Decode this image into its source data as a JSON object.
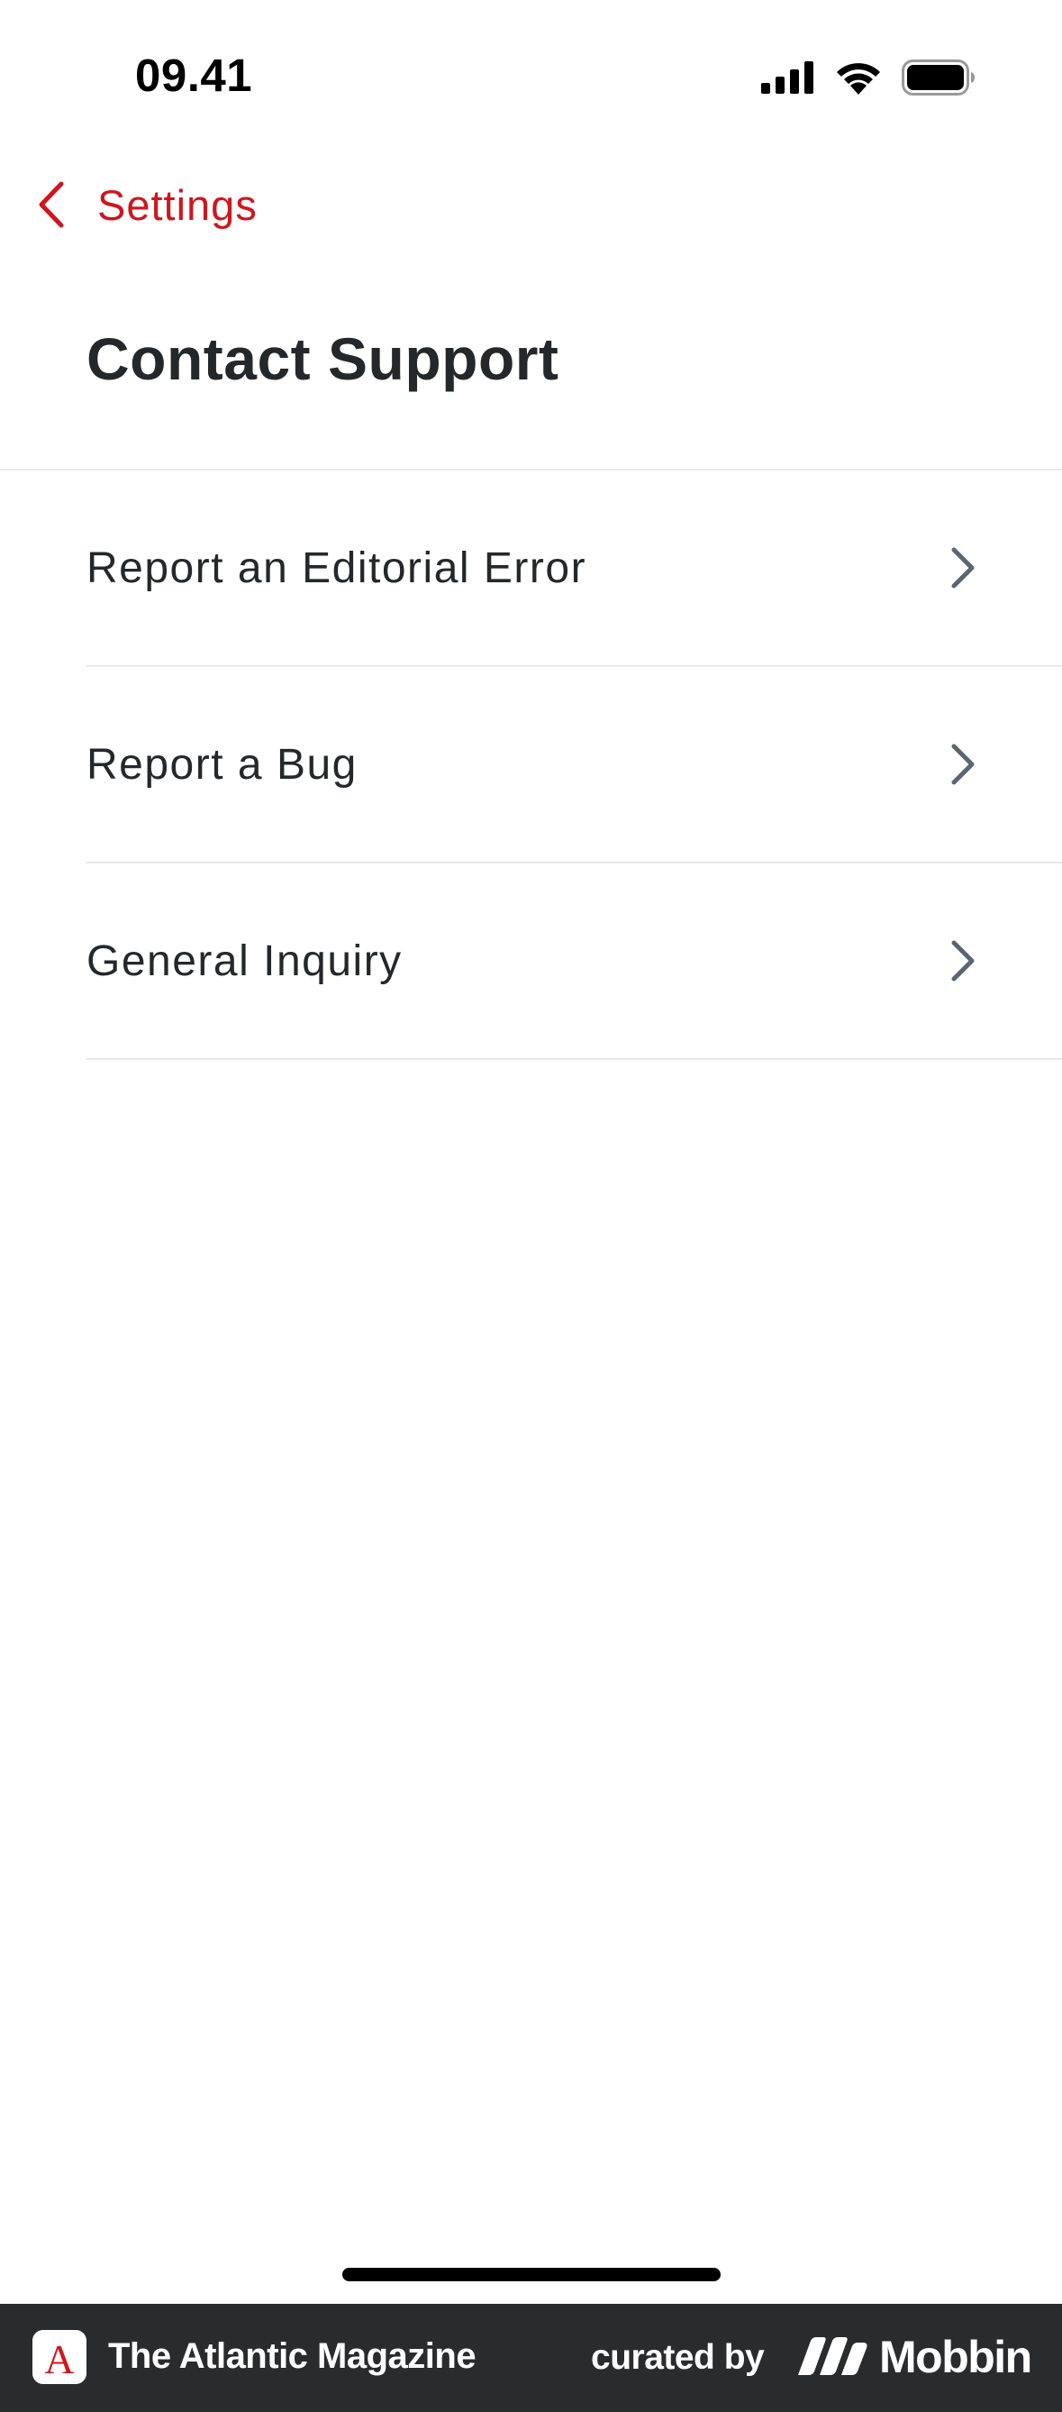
{
  "status_bar": {
    "time": "09.41",
    "icons": [
      "signal-icon",
      "wifi-icon",
      "battery-icon"
    ]
  },
  "nav": {
    "back_label": "Settings",
    "back_icon": "chevron-left-icon"
  },
  "page": {
    "title": "Contact Support"
  },
  "list": {
    "items": [
      {
        "label": "Report an Editorial Error",
        "icon": "chevron-right-icon"
      },
      {
        "label": "Report a Bug",
        "icon": "chevron-right-icon"
      },
      {
        "label": "General Inquiry",
        "icon": "chevron-right-icon"
      }
    ]
  },
  "footer": {
    "app_icon_letter": "A",
    "app_name": "The Atlantic Magazine",
    "curated_label": "curated by",
    "brand": "Mobbin"
  },
  "colors": {
    "accent": "#d0161d",
    "text": "#25282b",
    "divider": "#e7e8e9",
    "chevron": "#5c6670",
    "footer_bg": "#2a2b2d"
  }
}
